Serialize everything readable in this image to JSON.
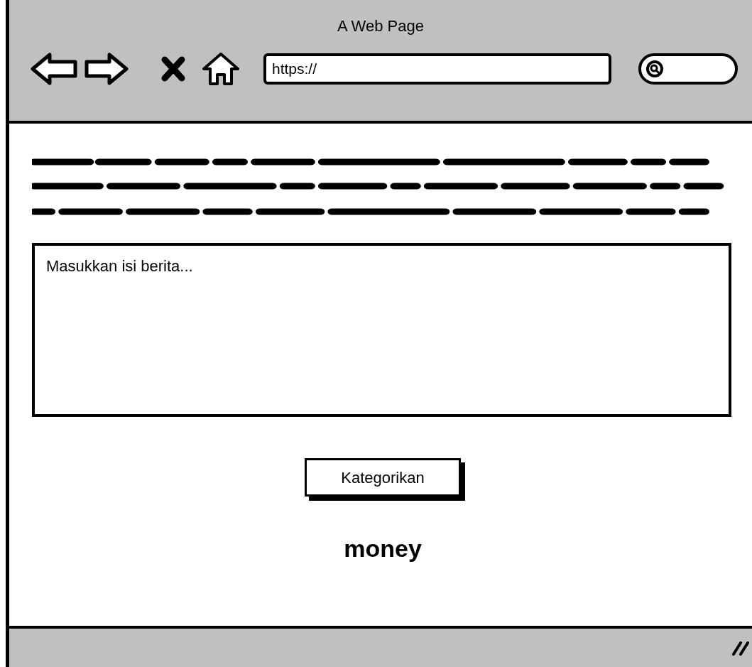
{
  "window": {
    "title": "A Web Page"
  },
  "address_bar": {
    "value": "https://"
  },
  "news_input": {
    "placeholder": "Masukkan isi berita..."
  },
  "button": {
    "label": "Kategorikan"
  },
  "result": {
    "text": "money"
  }
}
